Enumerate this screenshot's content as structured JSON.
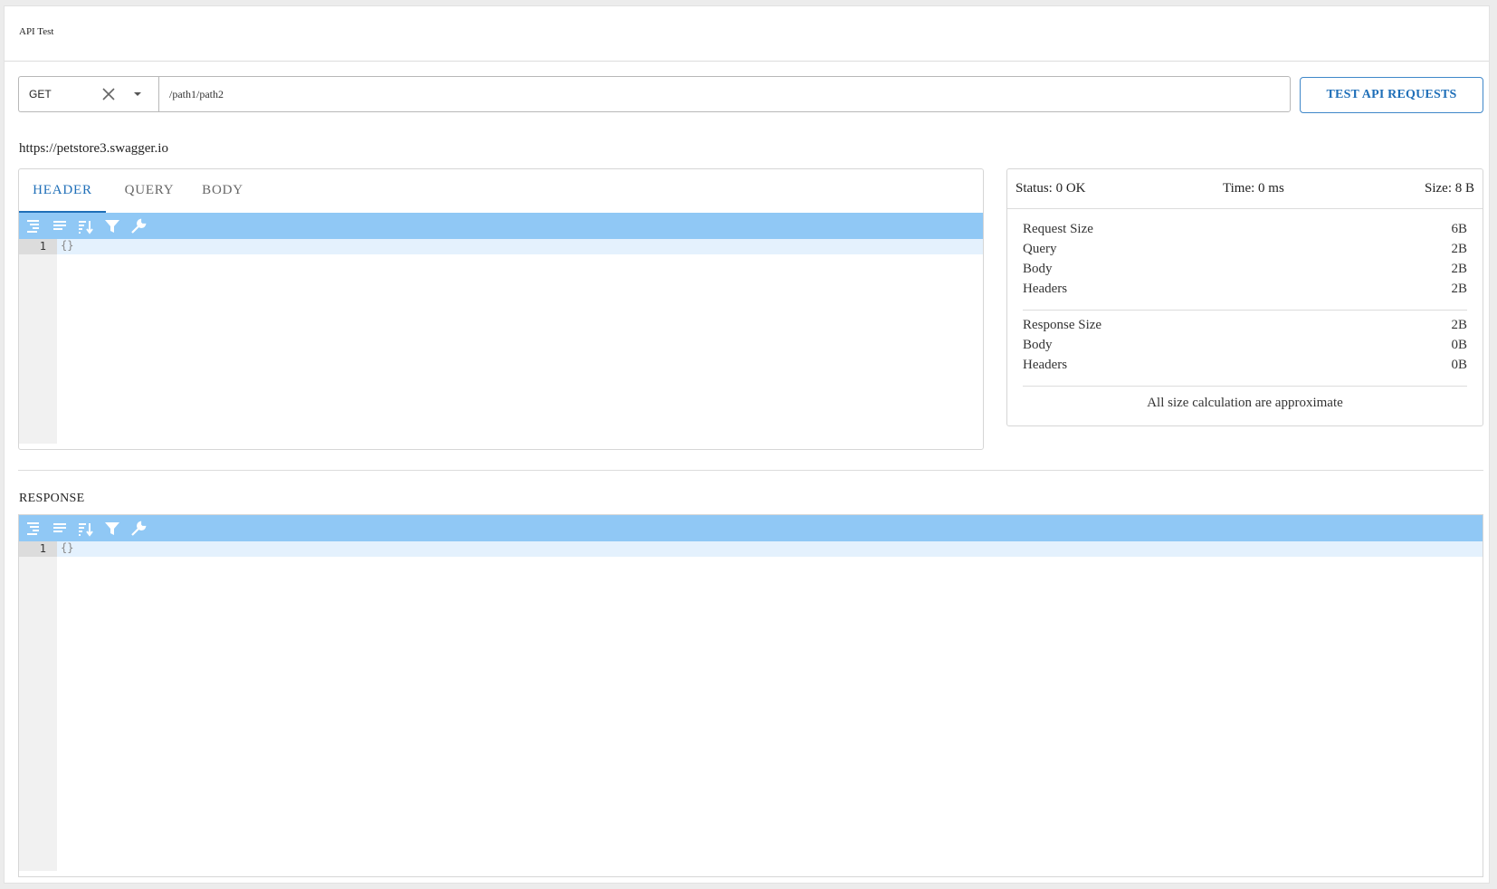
{
  "app": {
    "title": "API Test"
  },
  "request": {
    "method": "GET",
    "path": "/path1/path2",
    "test_button_label": "TEST API REQUESTS",
    "server_url": "https://petstore3.swagger.io",
    "tabs": [
      {
        "label": "HEADER",
        "active": true
      },
      {
        "label": "QUERY",
        "active": false
      },
      {
        "label": "BODY",
        "active": false
      }
    ],
    "editor": {
      "line_number": "1",
      "content": "{}"
    }
  },
  "stats": {
    "status": "Status: 0 OK",
    "time": "Time: 0 ms",
    "size": "Size: 8 B",
    "request_size": {
      "label": "Request Size",
      "value": "6B"
    },
    "request_query": {
      "label": "Query",
      "value": "2B"
    },
    "request_body": {
      "label": "Body",
      "value": "2B"
    },
    "request_headers": {
      "label": "Headers",
      "value": "2B"
    },
    "response_size": {
      "label": "Response Size",
      "value": "2B"
    },
    "response_body": {
      "label": "Body",
      "value": "0B"
    },
    "response_headers": {
      "label": "Headers",
      "value": "0B"
    },
    "note": "All size calculation are approximate"
  },
  "response": {
    "label": "RESPONSE",
    "editor": {
      "line_number": "1",
      "content": "{}"
    }
  },
  "colors": {
    "accent": "#1f6fb8",
    "toolbar": "#90c8f5",
    "active_line": "#e4f1fd"
  },
  "toolbar_icons": [
    "format-icon",
    "compact-icon",
    "sort-icon",
    "filter-icon",
    "repair-icon"
  ]
}
